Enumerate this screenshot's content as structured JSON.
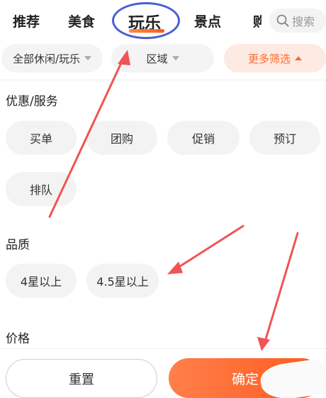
{
  "tabs": {
    "items": [
      "推荐",
      "美食",
      "玩乐",
      "景点"
    ],
    "active": "玩乐",
    "cut_tab": "购"
  },
  "search": {
    "placeholder": "搜索"
  },
  "filters": {
    "category": "全部休闲/玩乐",
    "region": "区域",
    "more": "更多筛选"
  },
  "sections": {
    "offers_title": "优惠/服务",
    "offers": [
      "买单",
      "团购",
      "促销",
      "预订",
      "排队"
    ],
    "quality_title": "品质",
    "quality": [
      "4星以上",
      "4.5星以上"
    ],
    "price_title": "价格"
  },
  "actions": {
    "reset": "重置",
    "confirm": "确定"
  },
  "colors": {
    "accent": "#ff6a2b",
    "annotation_arrow": "#f05454",
    "annotation_circle": "#4b5fd0"
  }
}
